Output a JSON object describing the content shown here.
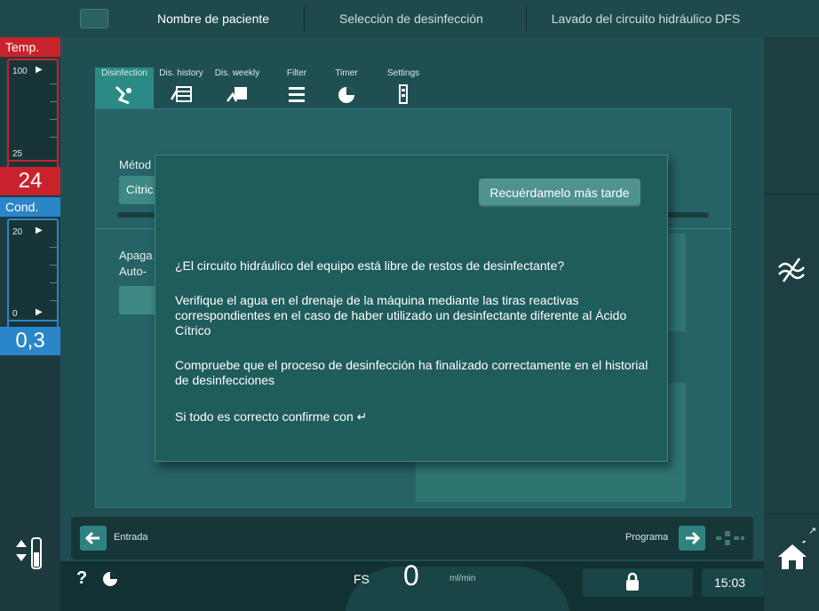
{
  "header": {
    "tabs": [
      "Nombre de paciente",
      "Selección de desinfección",
      "Lavado del circuito hidráulico DFS"
    ]
  },
  "left_panel": {
    "temp": {
      "title": "Temp.",
      "max_label": "100",
      "min_label": "25",
      "value": "24"
    },
    "cond": {
      "title": "Cond.",
      "max_label": "20",
      "min_label": "0",
      "value": "0,3"
    }
  },
  "tool_tabs": [
    {
      "label": "Disinfection",
      "icon": "disinfection-icon",
      "selected": true
    },
    {
      "label": "Dis. history",
      "icon": "history-icon",
      "selected": false
    },
    {
      "label": "Dis. weekly",
      "icon": "weekly-icon",
      "selected": false
    },
    {
      "label": "Filter",
      "icon": "filter-icon",
      "selected": false
    },
    {
      "label": "Timer",
      "icon": "timer-icon",
      "selected": false
    },
    {
      "label": "Settings",
      "icon": "settings-icon",
      "selected": false
    }
  ],
  "background": {
    "method_label": "Métod",
    "method_value": "Cítric",
    "shutdown_label": "Apaga",
    "auto_label": "Auto-"
  },
  "dialog": {
    "remind_button": "Recuérdamelo más tarde",
    "question": "¿El circuito hidráulico del equipo está libre de restos de desinfectante?",
    "instruction1": "Verifique el agua en el drenaje de la máquina mediante las tiras reactivas correspondientes en el caso de haber utilizado un desinfectante diferente al Ácido Cítrico",
    "instruction2": "Compruebe que el proceso de desinfección ha finalizado correctamente en el historial de desinfecciones",
    "confirm": "Si todo es correcto confirme con ↵"
  },
  "nav": {
    "back_label": "Entrada",
    "forward_label": "Programa"
  },
  "status": {
    "help": "?",
    "mode": "FS",
    "flow_value": "0",
    "flow_unit": "ml/min",
    "time": "15:03"
  },
  "colors": {
    "temp_accent": "#c8232c",
    "cond_accent": "#2a86c8",
    "selected_tab": "#2b8a86"
  }
}
